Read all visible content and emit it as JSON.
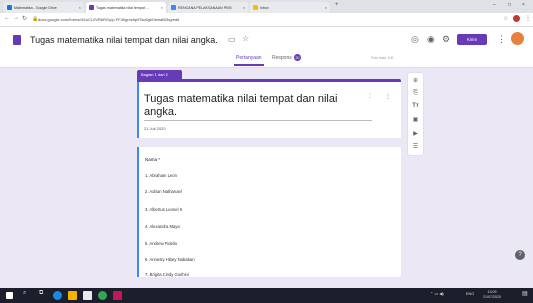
{
  "browser": {
    "tabs": [
      {
        "label": "Matematika - Google Drive",
        "color": "#1a73e8",
        "active": false
      },
      {
        "label": "Tugas matematika nilai tempat ...",
        "color": "#673ab7",
        "active": true
      },
      {
        "label": "RENCANA PELAKSANAAN PEM",
        "color": "#4285f4",
        "active": false
      },
      {
        "label": "Inbox",
        "color": "#fbbc04",
        "active": false
      }
    ],
    "url": "docs.google.com/forms/d/1sCL0VRbRGy/p-FF40gms9p9Tsc6gkOewaB2bg/edit"
  },
  "form_header": {
    "title": "Tugas matematika nilai tempat dan nilai angka.",
    "send_label": "Kirim",
    "tab_questions": "Pertanyaan",
    "tab_responses": "Respons",
    "responses_count": "20",
    "total_points": "Poin total: 100"
  },
  "form": {
    "section_label": "Bagian 1 dari 2",
    "title": "Tugas matematika nilai tempat dan nilai angka.",
    "date": "21 Juli 2020",
    "question_label": "Nama *",
    "options": [
      "1.  Abraham Leon",
      "2.  Adrian Nathanael",
      "3.  Albertus Leonel K",
      "4.  Alexandra Maya",
      "5.  Andrew Fidelio",
      "6.  Annesty Hilary Nababan",
      "7.  Brigita Cindy  Gushini"
    ]
  },
  "taskbar": {
    "tray_text": "ENG",
    "time": "13:09",
    "date": "21/07/2020"
  },
  "colors": {
    "accent": "#673ab7",
    "question_bar": "#4285f4",
    "page_bg": "#ece7f5"
  }
}
